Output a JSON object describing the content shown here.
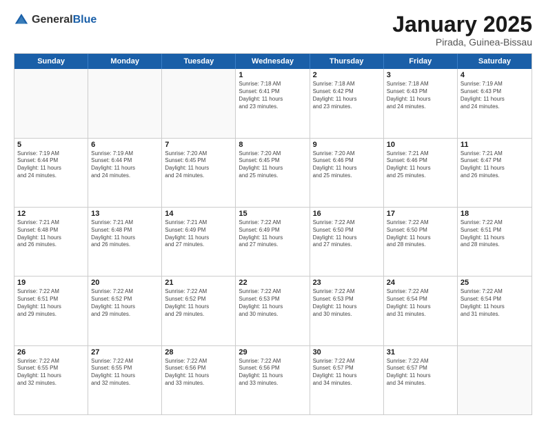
{
  "logo": {
    "general": "General",
    "blue": "Blue"
  },
  "header": {
    "month": "January 2025",
    "location": "Pirada, Guinea-Bissau"
  },
  "weekdays": [
    "Sunday",
    "Monday",
    "Tuesday",
    "Wednesday",
    "Thursday",
    "Friday",
    "Saturday"
  ],
  "rows": [
    [
      {
        "day": "",
        "lines": []
      },
      {
        "day": "",
        "lines": []
      },
      {
        "day": "",
        "lines": []
      },
      {
        "day": "1",
        "lines": [
          "Sunrise: 7:18 AM",
          "Sunset: 6:41 PM",
          "Daylight: 11 hours",
          "and 23 minutes."
        ]
      },
      {
        "day": "2",
        "lines": [
          "Sunrise: 7:18 AM",
          "Sunset: 6:42 PM",
          "Daylight: 11 hours",
          "and 23 minutes."
        ]
      },
      {
        "day": "3",
        "lines": [
          "Sunrise: 7:18 AM",
          "Sunset: 6:43 PM",
          "Daylight: 11 hours",
          "and 24 minutes."
        ]
      },
      {
        "day": "4",
        "lines": [
          "Sunrise: 7:19 AM",
          "Sunset: 6:43 PM",
          "Daylight: 11 hours",
          "and 24 minutes."
        ]
      }
    ],
    [
      {
        "day": "5",
        "lines": [
          "Sunrise: 7:19 AM",
          "Sunset: 6:44 PM",
          "Daylight: 11 hours",
          "and 24 minutes."
        ]
      },
      {
        "day": "6",
        "lines": [
          "Sunrise: 7:19 AM",
          "Sunset: 6:44 PM",
          "Daylight: 11 hours",
          "and 24 minutes."
        ]
      },
      {
        "day": "7",
        "lines": [
          "Sunrise: 7:20 AM",
          "Sunset: 6:45 PM",
          "Daylight: 11 hours",
          "and 24 minutes."
        ]
      },
      {
        "day": "8",
        "lines": [
          "Sunrise: 7:20 AM",
          "Sunset: 6:45 PM",
          "Daylight: 11 hours",
          "and 25 minutes."
        ]
      },
      {
        "day": "9",
        "lines": [
          "Sunrise: 7:20 AM",
          "Sunset: 6:46 PM",
          "Daylight: 11 hours",
          "and 25 minutes."
        ]
      },
      {
        "day": "10",
        "lines": [
          "Sunrise: 7:21 AM",
          "Sunset: 6:46 PM",
          "Daylight: 11 hours",
          "and 25 minutes."
        ]
      },
      {
        "day": "11",
        "lines": [
          "Sunrise: 7:21 AM",
          "Sunset: 6:47 PM",
          "Daylight: 11 hours",
          "and 26 minutes."
        ]
      }
    ],
    [
      {
        "day": "12",
        "lines": [
          "Sunrise: 7:21 AM",
          "Sunset: 6:48 PM",
          "Daylight: 11 hours",
          "and 26 minutes."
        ]
      },
      {
        "day": "13",
        "lines": [
          "Sunrise: 7:21 AM",
          "Sunset: 6:48 PM",
          "Daylight: 11 hours",
          "and 26 minutes."
        ]
      },
      {
        "day": "14",
        "lines": [
          "Sunrise: 7:21 AM",
          "Sunset: 6:49 PM",
          "Daylight: 11 hours",
          "and 27 minutes."
        ]
      },
      {
        "day": "15",
        "lines": [
          "Sunrise: 7:22 AM",
          "Sunset: 6:49 PM",
          "Daylight: 11 hours",
          "and 27 minutes."
        ]
      },
      {
        "day": "16",
        "lines": [
          "Sunrise: 7:22 AM",
          "Sunset: 6:50 PM",
          "Daylight: 11 hours",
          "and 27 minutes."
        ]
      },
      {
        "day": "17",
        "lines": [
          "Sunrise: 7:22 AM",
          "Sunset: 6:50 PM",
          "Daylight: 11 hours",
          "and 28 minutes."
        ]
      },
      {
        "day": "18",
        "lines": [
          "Sunrise: 7:22 AM",
          "Sunset: 6:51 PM",
          "Daylight: 11 hours",
          "and 28 minutes."
        ]
      }
    ],
    [
      {
        "day": "19",
        "lines": [
          "Sunrise: 7:22 AM",
          "Sunset: 6:51 PM",
          "Daylight: 11 hours",
          "and 29 minutes."
        ]
      },
      {
        "day": "20",
        "lines": [
          "Sunrise: 7:22 AM",
          "Sunset: 6:52 PM",
          "Daylight: 11 hours",
          "and 29 minutes."
        ]
      },
      {
        "day": "21",
        "lines": [
          "Sunrise: 7:22 AM",
          "Sunset: 6:52 PM",
          "Daylight: 11 hours",
          "and 29 minutes."
        ]
      },
      {
        "day": "22",
        "lines": [
          "Sunrise: 7:22 AM",
          "Sunset: 6:53 PM",
          "Daylight: 11 hours",
          "and 30 minutes."
        ]
      },
      {
        "day": "23",
        "lines": [
          "Sunrise: 7:22 AM",
          "Sunset: 6:53 PM",
          "Daylight: 11 hours",
          "and 30 minutes."
        ]
      },
      {
        "day": "24",
        "lines": [
          "Sunrise: 7:22 AM",
          "Sunset: 6:54 PM",
          "Daylight: 11 hours",
          "and 31 minutes."
        ]
      },
      {
        "day": "25",
        "lines": [
          "Sunrise: 7:22 AM",
          "Sunset: 6:54 PM",
          "Daylight: 11 hours",
          "and 31 minutes."
        ]
      }
    ],
    [
      {
        "day": "26",
        "lines": [
          "Sunrise: 7:22 AM",
          "Sunset: 6:55 PM",
          "Daylight: 11 hours",
          "and 32 minutes."
        ]
      },
      {
        "day": "27",
        "lines": [
          "Sunrise: 7:22 AM",
          "Sunset: 6:55 PM",
          "Daylight: 11 hours",
          "and 32 minutes."
        ]
      },
      {
        "day": "28",
        "lines": [
          "Sunrise: 7:22 AM",
          "Sunset: 6:56 PM",
          "Daylight: 11 hours",
          "and 33 minutes."
        ]
      },
      {
        "day": "29",
        "lines": [
          "Sunrise: 7:22 AM",
          "Sunset: 6:56 PM",
          "Daylight: 11 hours",
          "and 33 minutes."
        ]
      },
      {
        "day": "30",
        "lines": [
          "Sunrise: 7:22 AM",
          "Sunset: 6:57 PM",
          "Daylight: 11 hours",
          "and 34 minutes."
        ]
      },
      {
        "day": "31",
        "lines": [
          "Sunrise: 7:22 AM",
          "Sunset: 6:57 PM",
          "Daylight: 11 hours",
          "and 34 minutes."
        ]
      },
      {
        "day": "",
        "lines": []
      }
    ]
  ]
}
